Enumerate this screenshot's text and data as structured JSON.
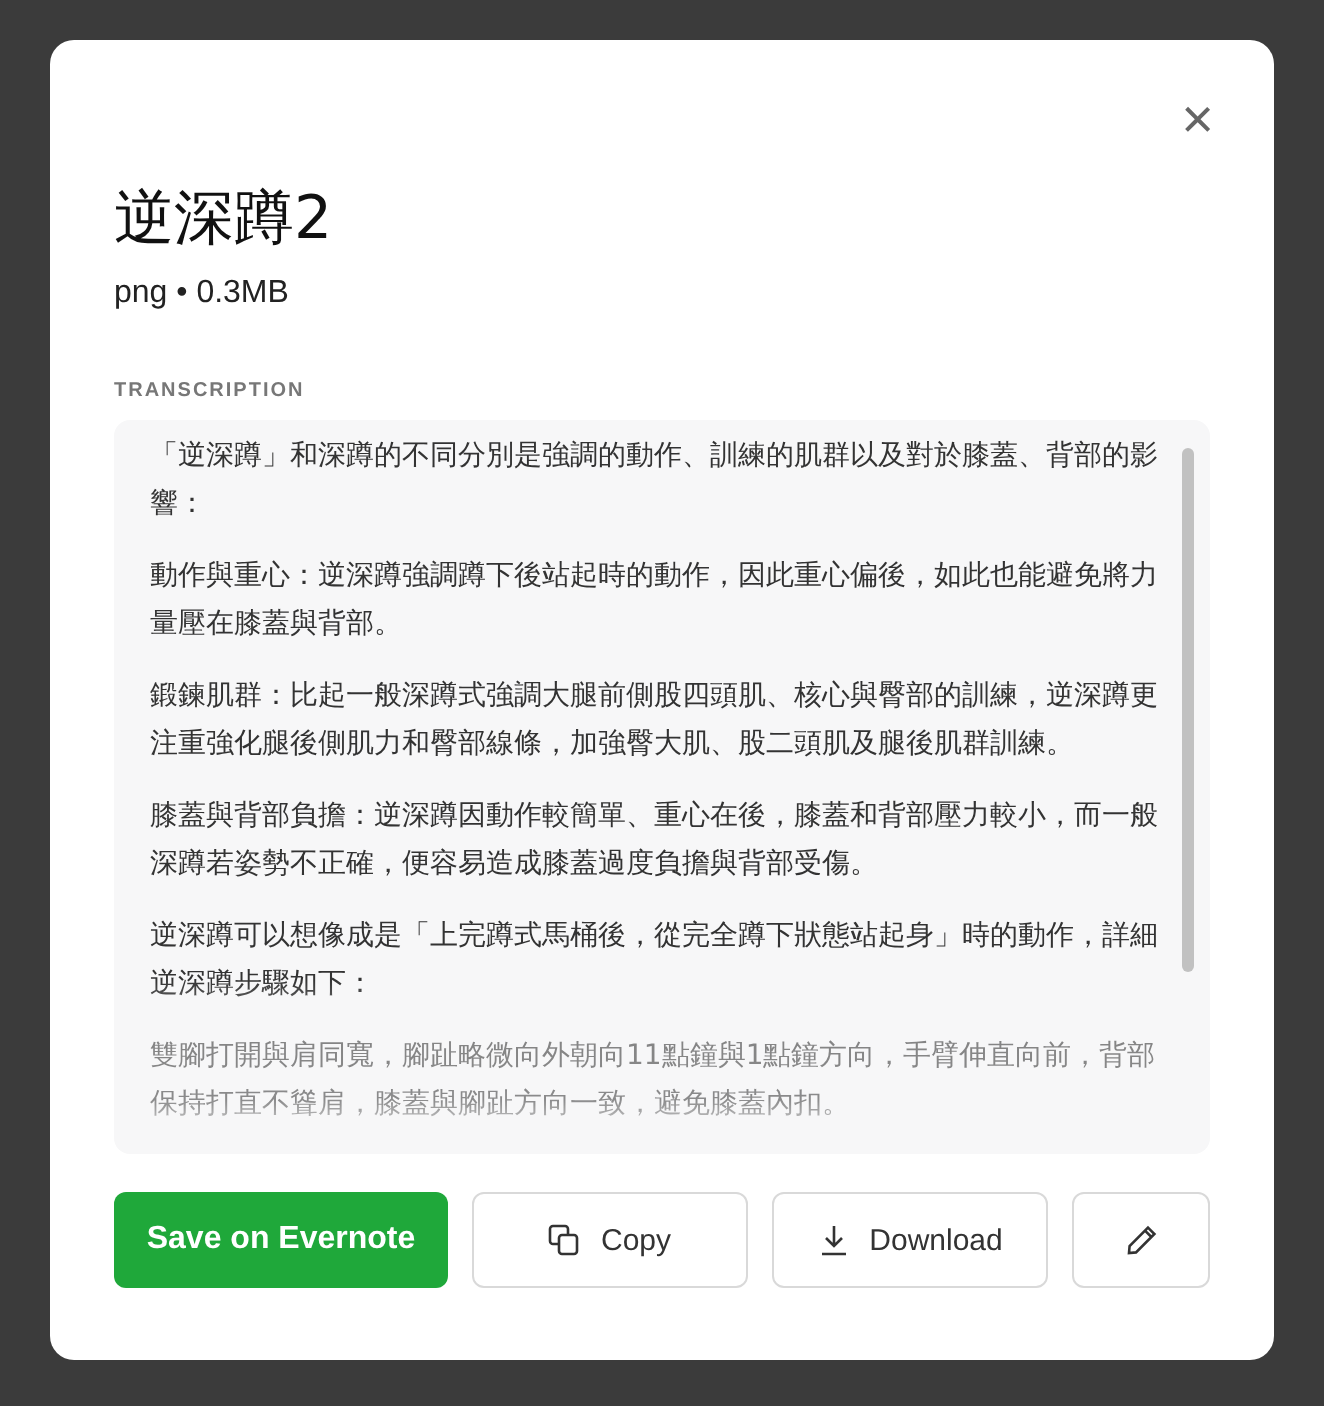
{
  "dialog": {
    "title": "逆深蹲2",
    "file_info": "png • 0.3MB",
    "close_button": "×"
  },
  "transcription": {
    "heading": "TRANSCRIPTION",
    "paragraphs": [
      "「逆深蹲」和深蹲的不同分別是強調的動作、訓練的肌群以及對於膝蓋、背部的影響：",
      "動作與重心：逆深蹲強調蹲下後站起時的動作，因此重心偏後，如此也能避免將力量壓在膝蓋與背部。",
      "鍛鍊肌群：比起一般深蹲式強調大腿前側股四頭肌、核心與臀部的訓練，逆深蹲更注重強化腿後側肌力和臀部線條，加強臀大肌、股二頭肌及腿後肌群訓練。",
      "膝蓋與背部負擔：逆深蹲因動作較簡單、重心在後，膝蓋和背部壓力較小，而一般深蹲若姿勢不正確，便容易造成膝蓋過度負擔與背部受傷。",
      "逆深蹲可以想像成是「上完蹲式馬桶後，從完全蹲下狀態站起身」時的動作，詳細逆深蹲步驟如下：",
      "雙腳打開與肩同寬，腳趾略微向外朝向11點鐘與1點鐘方向，手臂伸直向前，背部保持打直不聳肩，膝蓋與腳趾方向一致，避免膝蓋內扣。"
    ]
  },
  "buttons": [
    {
      "kind": "primary",
      "label": "Save on Evernote"
    },
    {
      "kind": "copy",
      "label": "Copy"
    },
    {
      "kind": "download",
      "label": "Download"
    },
    {
      "kind": "edit"
    }
  ]
}
